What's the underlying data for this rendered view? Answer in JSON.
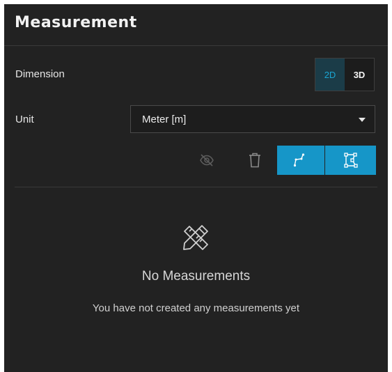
{
  "panel": {
    "title": "Measurement"
  },
  "dimension": {
    "label": "Dimension",
    "options": [
      "2D",
      "3D"
    ],
    "selected": "2D",
    "active_color": "#1aa6d3"
  },
  "unit": {
    "label": "Unit",
    "value": "Meter [m]"
  },
  "toolbar": {
    "icons": [
      "eye-slash-icon",
      "trash-icon",
      "polyline-measure-icon",
      "area-measure-icon"
    ],
    "accent": "#1696c8"
  },
  "empty_state": {
    "icon": "ruler-pencil-icon",
    "title": "No Measurements",
    "message": "You have not created any measurements yet"
  }
}
